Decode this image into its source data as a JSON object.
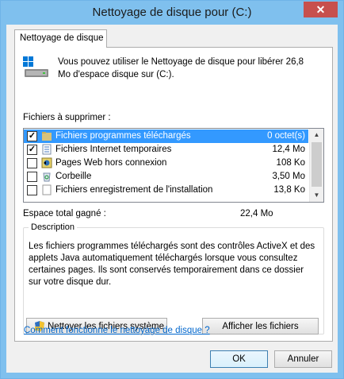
{
  "window": {
    "title": "Nettoyage de disque pour  (C:)",
    "close_label": "✕"
  },
  "tab": {
    "label": "Nettoyage de disque"
  },
  "intro": "Vous pouvez utiliser le Nettoyage de disque pour libérer 26,8 Mo d'espace disque sur  (C:).",
  "files_label": "Fichiers à supprimer :",
  "files": [
    {
      "name": "Fichiers programmes téléchargés",
      "size": "0 octet(s)",
      "checked": true,
      "selected": true,
      "icon": "folder-icon"
    },
    {
      "name": "Fichiers Internet temporaires",
      "size": "12,4 Mo",
      "checked": true,
      "selected": false,
      "icon": "document-icon"
    },
    {
      "name": "Pages Web hors connexion",
      "size": "108 Ko",
      "checked": false,
      "selected": false,
      "icon": "offline-pages-icon"
    },
    {
      "name": "Corbeille",
      "size": "3,50 Mo",
      "checked": false,
      "selected": false,
      "icon": "recycle-bin-icon"
    },
    {
      "name": "Fichiers enregistrement de l'installation",
      "size": "13,8 Ko",
      "checked": false,
      "selected": false,
      "icon": "log-file-icon"
    }
  ],
  "total": {
    "label": "Espace total gagné :",
    "value": "22,4 Mo"
  },
  "description": {
    "title": "Description",
    "text": "Les fichiers programmes téléchargés sont des contrôles ActiveX et des applets Java automatiquement téléchargés lorsque vous consultez certaines pages. Ils sont conservés temporairement dans ce dossier sur votre disque dur."
  },
  "buttons": {
    "clean_system": "Nettoyer les fichiers système",
    "show_files": "Afficher les fichiers",
    "ok": "OK",
    "cancel": "Annuler"
  },
  "help_link": "Comment fonctionne le nettoyage de disque ?",
  "colors": {
    "selection": "#3399ff",
    "titlebar": "#7fc0ee",
    "close": "#c7504d",
    "link": "#0066cc"
  }
}
